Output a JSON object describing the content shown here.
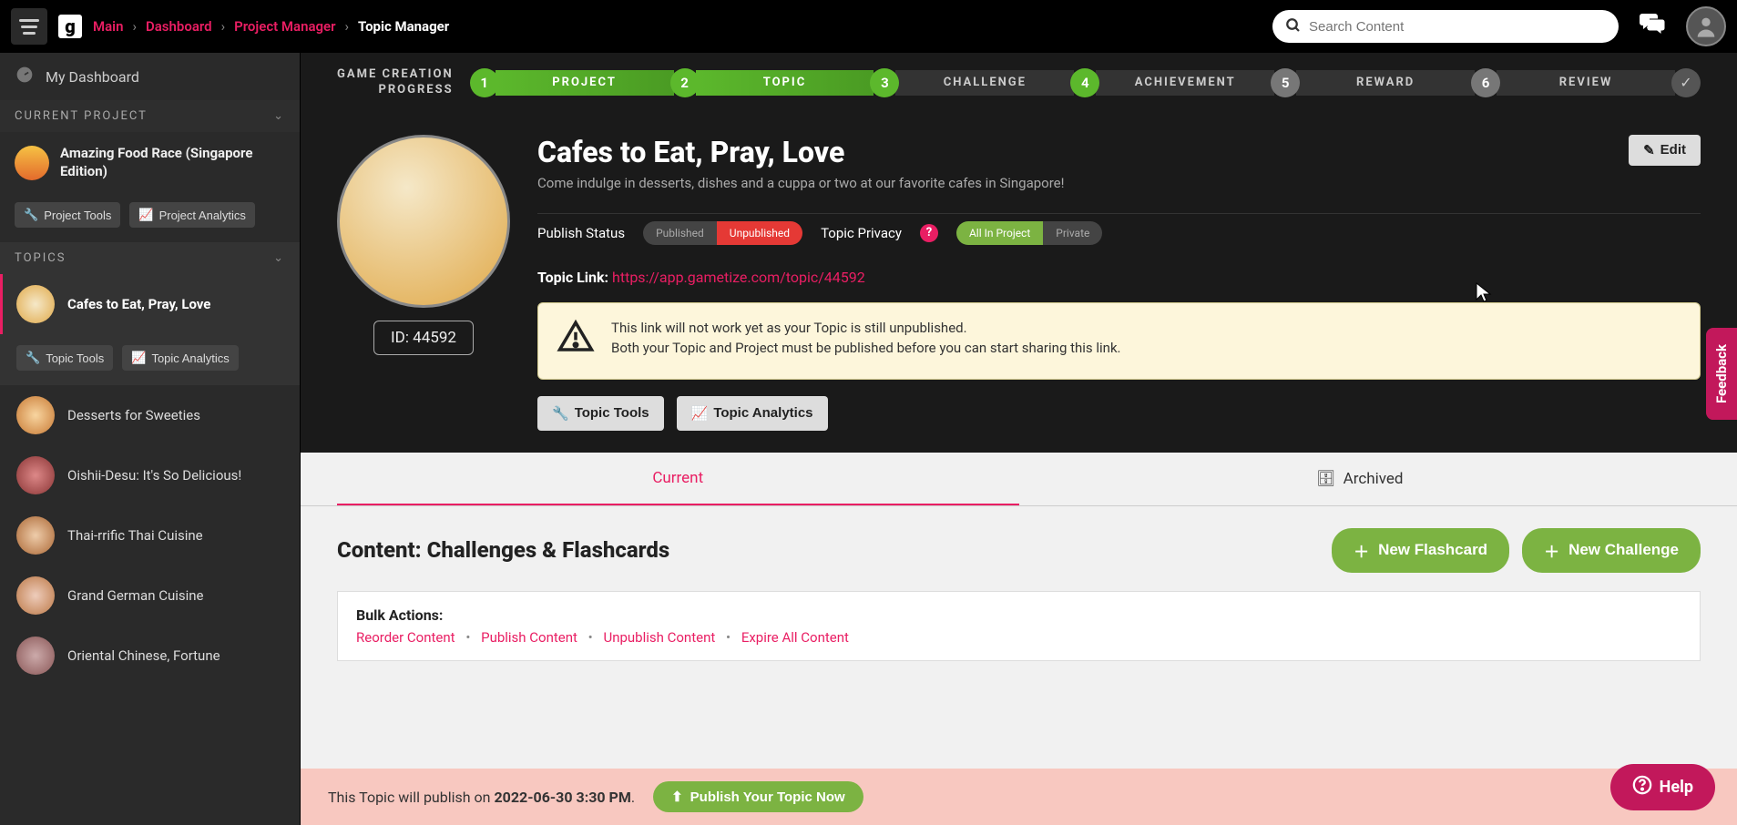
{
  "breadcrumb": {
    "main": "Main",
    "dashboard": "Dashboard",
    "project_manager": "Project Manager",
    "topic_manager": "Topic Manager"
  },
  "search": {
    "placeholder": "Search Content"
  },
  "sidebar": {
    "my_dashboard": "My Dashboard",
    "current_project_label": "CURRENT PROJECT",
    "project_name": "Amazing Food Race (Singapore Edition)",
    "project_tools": "Project Tools",
    "project_analytics": "Project Analytics",
    "topics_label": "TOPICS",
    "topic_tools": "Topic Tools",
    "topic_analytics": "Topic Analytics",
    "topics": [
      {
        "label": "Cafes to Eat, Pray, Love"
      },
      {
        "label": "Desserts for Sweeties"
      },
      {
        "label": "Oishii-Desu: It's So Delicious!"
      },
      {
        "label": "Thai-rrific Thai Cuisine"
      },
      {
        "label": "Grand German Cuisine"
      },
      {
        "label": "Oriental Chinese, Fortune"
      }
    ]
  },
  "progress": {
    "label1": "GAME CREATION",
    "label2": "PROGRESS",
    "steps": [
      {
        "num": "1",
        "name": "PROJECT"
      },
      {
        "num": "2",
        "name": "TOPIC"
      },
      {
        "num": "3",
        "name": "CHALLENGE"
      },
      {
        "num": "4",
        "name": "ACHIEVEMENT"
      },
      {
        "num": "5",
        "name": "REWARD"
      },
      {
        "num": "6",
        "name": "REVIEW"
      }
    ]
  },
  "topic": {
    "title": "Cafes to Eat, Pray, Love",
    "desc": "Come indulge in desserts, dishes and a cuppa or two at our favorite cafes in Singapore!",
    "edit": "Edit",
    "id_label": "ID: 44592",
    "publish_status_label": "Publish Status",
    "published_opt": "Published",
    "unpublished_opt": "Unpublished",
    "privacy_label": "Topic Privacy",
    "privacy_all": "All In Project",
    "privacy_private": "Private",
    "link_label": "Topic Link:",
    "link_url": "https://app.gametize.com/topic/44592",
    "warn_line1": "This link will not work yet as your Topic is still unpublished.",
    "warn_line2": "Both your Topic and Project must be published before you can start sharing this link.",
    "tools_btn": "Topic Tools",
    "analytics_btn": "Topic Analytics"
  },
  "content": {
    "tab_current": "Current",
    "tab_archived": "Archived",
    "title": "Content: Challenges & Flashcards",
    "new_flashcard": "New Flashcard",
    "new_challenge": "New Challenge",
    "bulk_label": "Bulk Actions:",
    "bulk_links": {
      "reorder": "Reorder Content",
      "publish": "Publish Content",
      "unpublish": "Unpublish Content",
      "expire": "Expire All Content"
    }
  },
  "banner": {
    "text_prefix": "This Topic will publish on ",
    "date": "2022-06-30 3:30 PM",
    "publish_now": "Publish Your Topic Now"
  },
  "feedback": "Feedback",
  "help": "Help"
}
